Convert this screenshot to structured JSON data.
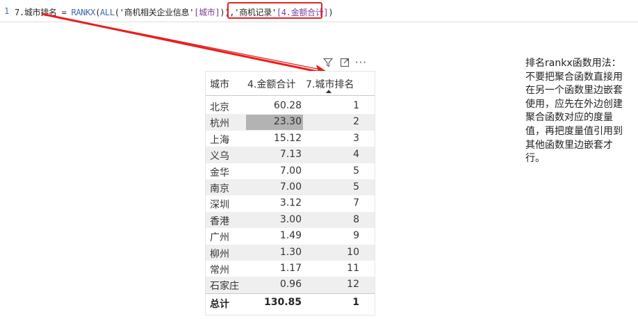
{
  "formula": {
    "line_number": "1",
    "measure_name": "7.城市排名",
    "equals": " = ",
    "func_rankx": "RANKX",
    "open_paren_1": "(",
    "func_all": "ALL",
    "open_paren_2": "(",
    "table_name": "'商机相关企业信息'",
    "column_ref": "[城市]",
    "close_parens": ")),",
    "table_ref_highlighted": "'商机记录'",
    "measure_ref_highlighted": "[4.金额合计]",
    "close_paren_final": ")",
    "highlight_color": "#e8201f"
  },
  "visual_header": {
    "icons": [
      "filter-icon",
      "focus-mode-icon",
      "more-options-icon"
    ],
    "more_label": "···"
  },
  "table": {
    "columns": [
      "城市",
      "4.金额合计",
      "7.城市排名"
    ],
    "sorted_column": "7.城市排名",
    "rows": [
      {
        "city": "北京",
        "amount": "60.28",
        "rank": "1"
      },
      {
        "city": "杭州",
        "amount": "23.30",
        "rank": "2"
      },
      {
        "city": "上海",
        "amount": "15.12",
        "rank": "3"
      },
      {
        "city": "义乌",
        "amount": "7.13",
        "rank": "4"
      },
      {
        "city": "金华",
        "amount": "7.00",
        "rank": "5"
      },
      {
        "city": "南京",
        "amount": "7.00",
        "rank": "5"
      },
      {
        "city": "深圳",
        "amount": "3.12",
        "rank": "7"
      },
      {
        "city": "香港",
        "amount": "3.00",
        "rank": "8"
      },
      {
        "city": "广州",
        "amount": "1.49",
        "rank": "9"
      },
      {
        "city": "柳州",
        "amount": "1.30",
        "rank": "10"
      },
      {
        "city": "常州",
        "amount": "1.17",
        "rank": "11"
      },
      {
        "city": "石家庄",
        "amount": "0.96",
        "rank": "12"
      }
    ],
    "selected_row_index": 1,
    "total": {
      "label": "总计",
      "amount": "130.85",
      "rank": "1"
    }
  },
  "note": {
    "text": "排名rankx函数用法：不要把聚合函数直接用在另一个函数里边嵌套使用，应先在外边创建聚合函数对应的度量值，再把度量值引用到其他函数里边嵌套才行。"
  }
}
